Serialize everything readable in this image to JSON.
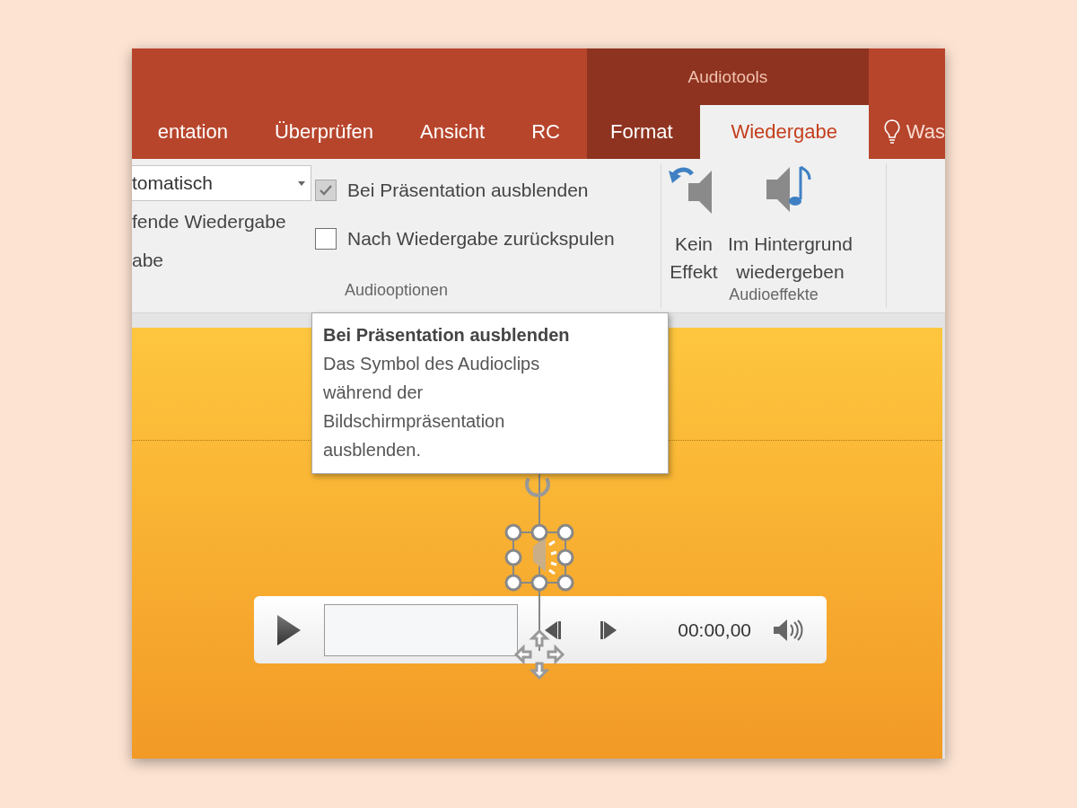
{
  "tabs": [
    {
      "label": "entation",
      "selected": false
    },
    {
      "label": "Überprüfen",
      "selected": false
    },
    {
      "label": "Ansicht",
      "selected": false
    },
    {
      "label": "RC",
      "selected": false
    }
  ],
  "contextual_group": {
    "title": "Audiotools",
    "tabs": [
      {
        "label": "Format",
        "selected": false
      },
      {
        "label": "Wiedergabe",
        "selected": true
      }
    ]
  },
  "tell_me": {
    "label": "Was"
  },
  "audio_options": {
    "start_dropdown": {
      "value": "tomatisch"
    },
    "cut_options": [
      "fende Wiedergabe",
      "abe"
    ],
    "checkboxes": [
      {
        "label": "Bei Präsentation ausblenden",
        "checked": true
      },
      {
        "label": "Nach Wiedergabe zurückspulen",
        "checked": false
      }
    ],
    "group_label": "Audiooptionen"
  },
  "audio_effects": {
    "buttons": [
      {
        "kind": "none",
        "lines": [
          "Kein",
          "Effekt"
        ]
      },
      {
        "kind": "background",
        "lines": [
          "Im Hintergrund",
          "wiedergeben"
        ]
      }
    ],
    "group_label": "Audioeffekte"
  },
  "tooltip": {
    "title": "Bei Präsentation ausblenden",
    "body": "Das Symbol des Audioclips während der Bildschirmpräsentation ausblenden."
  },
  "player": {
    "time": "00:00,00"
  }
}
